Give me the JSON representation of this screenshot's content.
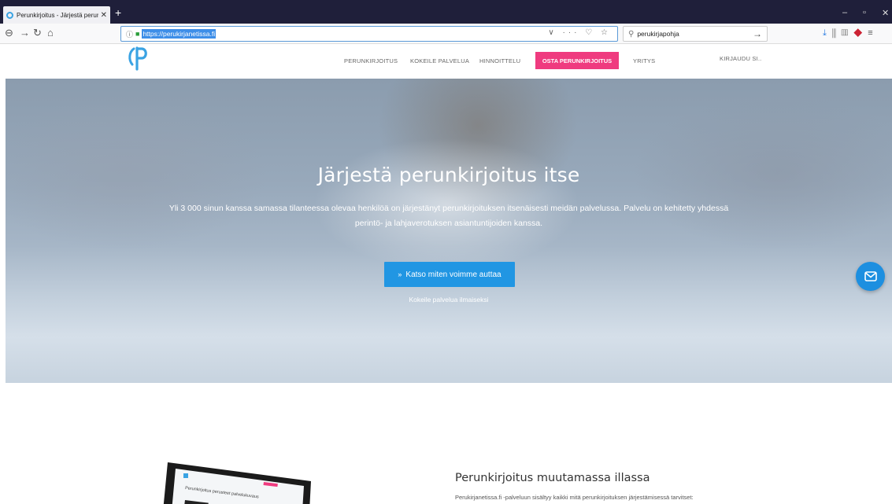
{
  "browser": {
    "tab_title": "Perunkirjoitus - Järjestä perunki",
    "tab_close": "✕",
    "new_tab": "+",
    "url": "https://perukirjanetissa.fi",
    "search_value": "perukirjapohja",
    "window_controls": [
      "–",
      "▫",
      "✕"
    ]
  },
  "site": {
    "menu": [
      "PERUNKIRJOITUS",
      "KOKEILE PALVELUA",
      "HINNOITTELU",
      "OSTA PERUNKIRJOITUS",
      "YRITYS",
      "KIRJAUDU SI.."
    ],
    "brand_color": "#ef3b7f",
    "accent_color": "#2196e3"
  },
  "hero": {
    "title": "Järjestä perunkirjoitus itse",
    "subtitle": "Yli 3 000 sinun kanssa samassa tilanteessa olevaa henkilöä on järjestänyt perunkirjoituksen itsenäisesti meidän palvelussa. Palvelu on kehitetty yhdessä perintö- ja lahjaverotuksen asiantuntijoiden kanssa.",
    "button_label": "Katso miten voimme auttaa",
    "link_label": "Kokeile palvelua ilmaiseksi"
  },
  "section": {
    "title": "Perunkirjoitus muutamassa illassa",
    "text": "Perukirjanetissa.fi -palveluun sisältyy kaikki mitä perunkirjoituksen järjestämisessä tarvitset:",
    "laptop_caption": "Perunkirjoitus perusteet palvelukuvaus"
  },
  "icons": {
    "favicon": "logo-icon",
    "mail": "mail-icon"
  }
}
